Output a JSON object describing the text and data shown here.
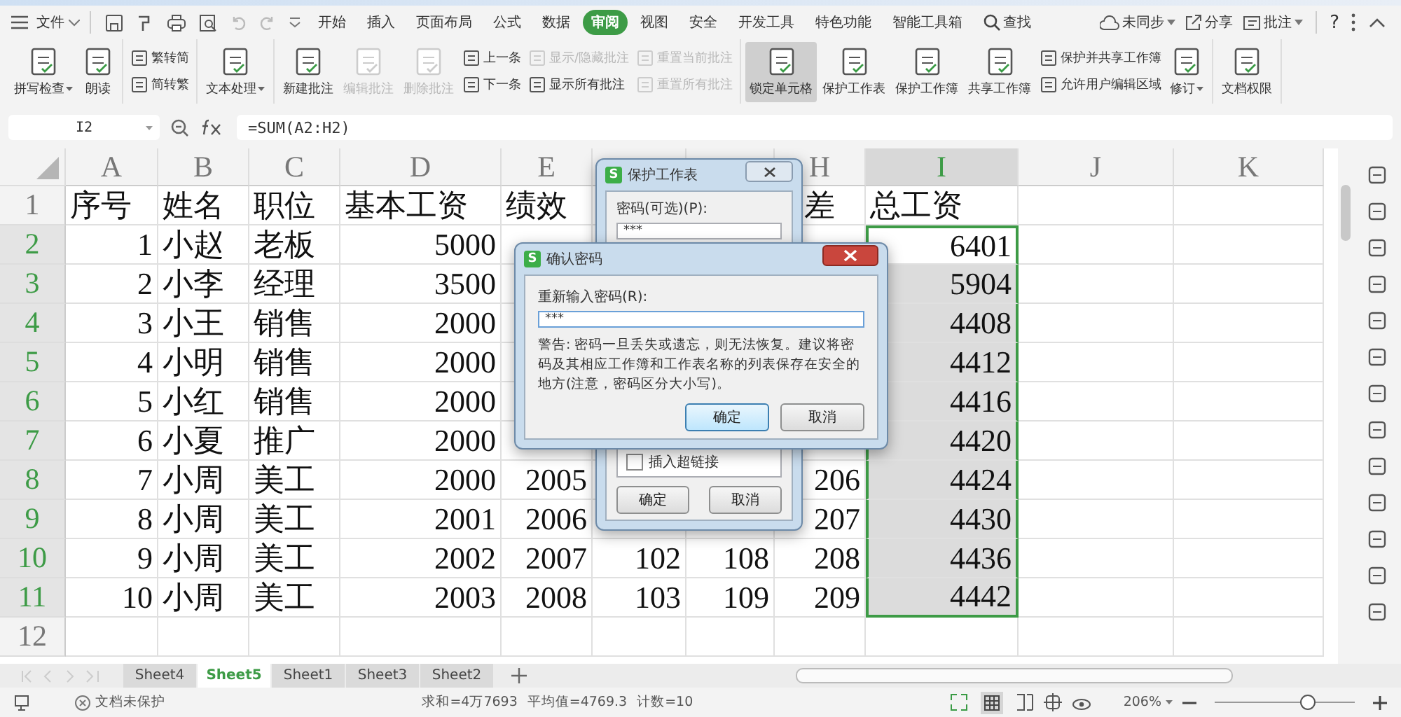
{
  "menu_bar": {
    "file": "文件",
    "tabs": [
      {
        "label": "开始",
        "selected": false
      },
      {
        "label": "插入",
        "selected": false
      },
      {
        "label": "页面布局",
        "selected": false
      },
      {
        "label": "公式",
        "selected": false
      },
      {
        "label": "数据",
        "selected": false
      },
      {
        "label": "审阅",
        "selected": true
      },
      {
        "label": "视图",
        "selected": false
      },
      {
        "label": "安全",
        "selected": false
      },
      {
        "label": "开发工具",
        "selected": false
      },
      {
        "label": "特色功能",
        "selected": false
      },
      {
        "label": "智能工具箱",
        "selected": false
      }
    ],
    "search": "查找",
    "sync": "未同步",
    "share": "分享",
    "comment": "批注",
    "help": "?"
  },
  "ribbon": [
    {
      "columns": [
        {
          "items": [
            {
              "kind": "large",
              "label": "拼写检查",
              "dropdown": true,
              "disabled": false,
              "pressed": false
            }
          ]
        },
        {
          "items": [
            {
              "kind": "large",
              "label": "朗读",
              "dropdown": false,
              "disabled": false,
              "pressed": false
            }
          ]
        }
      ]
    },
    {
      "columns": [
        {
          "items": [
            {
              "kind": "small",
              "label": "繁转简",
              "disabled": false
            },
            {
              "kind": "small",
              "label": "简转繁",
              "disabled": false
            }
          ]
        }
      ]
    },
    {
      "columns": [
        {
          "items": [
            {
              "kind": "large",
              "label": "文本处理",
              "dropdown": true,
              "disabled": false,
              "pressed": false
            }
          ]
        }
      ]
    },
    {
      "columns": [
        {
          "items": [
            {
              "kind": "large",
              "label": "新建批注",
              "dropdown": false,
              "disabled": false,
              "pressed": false
            }
          ]
        },
        {
          "items": [
            {
              "kind": "large",
              "label": "编辑批注",
              "dropdown": false,
              "disabled": true,
              "pressed": false
            }
          ]
        },
        {
          "items": [
            {
              "kind": "large",
              "label": "删除批注",
              "dropdown": false,
              "disabled": true,
              "pressed": false
            }
          ]
        },
        {
          "items": [
            {
              "kind": "small",
              "label": "上一条",
              "disabled": false
            },
            {
              "kind": "small",
              "label": "下一条",
              "disabled": false
            }
          ]
        },
        {
          "items": [
            {
              "kind": "small",
              "label": "显示/隐藏批注",
              "disabled": true
            },
            {
              "kind": "small",
              "label": "显示所有批注",
              "disabled": false
            }
          ]
        },
        {
          "items": [
            {
              "kind": "small",
              "label": "重置当前批注",
              "disabled": true
            },
            {
              "kind": "small",
              "label": "重置所有批注",
              "disabled": true
            }
          ]
        }
      ]
    },
    {
      "columns": [
        {
          "items": [
            {
              "kind": "large",
              "label": "锁定单元格",
              "dropdown": false,
              "disabled": false,
              "pressed": true
            }
          ]
        },
        {
          "items": [
            {
              "kind": "large",
              "label": "保护工作表",
              "dropdown": false,
              "disabled": false,
              "pressed": false
            }
          ]
        },
        {
          "items": [
            {
              "kind": "large",
              "label": "保护工作簿",
              "dropdown": false,
              "disabled": false,
              "pressed": false
            }
          ]
        },
        {
          "items": [
            {
              "kind": "large",
              "label": "共享工作簿",
              "dropdown": false,
              "disabled": false,
              "pressed": false
            }
          ]
        },
        {
          "items": [
            {
              "kind": "small",
              "label": "保护并共享工作簿",
              "disabled": false
            },
            {
              "kind": "small",
              "label": "允许用户编辑区域",
              "disabled": false
            }
          ]
        },
        {
          "items": [
            {
              "kind": "large",
              "label": "修订",
              "dropdown": true,
              "disabled": false,
              "pressed": false
            }
          ]
        }
      ]
    },
    {
      "columns": [
        {
          "items": [
            {
              "kind": "large",
              "label": "文档权限",
              "dropdown": false,
              "disabled": false,
              "pressed": false
            }
          ]
        }
      ]
    }
  ],
  "formula_bar": {
    "name_box": "I2",
    "formula": "=SUM(A2:H2)"
  },
  "sheet": {
    "columns": [
      {
        "label": "A",
        "selected": false
      },
      {
        "label": "B",
        "selected": false
      },
      {
        "label": "C",
        "selected": false
      },
      {
        "label": "D",
        "selected": false
      },
      {
        "label": "E",
        "selected": false
      },
      {
        "selected": false
      },
      {
        "selected": false
      },
      {
        "label": "H",
        "selected": false
      },
      {
        "label": "I",
        "selected": true
      },
      {
        "label": "J",
        "selected": false
      },
      {
        "label": "K",
        "selected": false
      }
    ],
    "rows": [
      {
        "num": "1",
        "kind": "header",
        "selected": false,
        "cells": [
          "序号",
          "姓名",
          "职位",
          "基本工资",
          "绩效",
          null,
          null,
          "差",
          "总工资"
        ]
      },
      {
        "num": "2",
        "kind": "data",
        "selected": true,
        "cells": [
          "1",
          "小赵",
          "老板",
          "5000",
          null,
          null,
          null,
          null,
          "6401"
        ]
      },
      {
        "num": "3",
        "kind": "data",
        "selected": true,
        "cells": [
          "2",
          "小李",
          "经理",
          "3500",
          null,
          null,
          null,
          null,
          "5904"
        ]
      },
      {
        "num": "4",
        "kind": "data",
        "selected": true,
        "cells": [
          "3",
          "小王",
          "销售",
          "2000",
          null,
          null,
          null,
          null,
          "4408"
        ]
      },
      {
        "num": "5",
        "kind": "data",
        "selected": true,
        "cells": [
          "4",
          "小明",
          "销售",
          "2000",
          null,
          null,
          null,
          null,
          "4412"
        ]
      },
      {
        "num": "6",
        "kind": "data",
        "selected": true,
        "cells": [
          "5",
          "小红",
          "销售",
          "2000",
          null,
          null,
          null,
          null,
          "4416"
        ]
      },
      {
        "num": "7",
        "kind": "data",
        "selected": true,
        "cells": [
          "6",
          "小夏",
          "推广",
          "2000",
          null,
          null,
          null,
          null,
          "4420"
        ]
      },
      {
        "num": "8",
        "kind": "data",
        "selected": true,
        "cells": [
          "7",
          "小周",
          "美工",
          "2000",
          "2005",
          null,
          null,
          "206",
          "4424"
        ]
      },
      {
        "num": "9",
        "kind": "data",
        "selected": true,
        "cells": [
          "8",
          "小周",
          "美工",
          "2001",
          "2006",
          null,
          null,
          "207",
          "4430"
        ]
      },
      {
        "num": "10",
        "kind": "data",
        "selected": true,
        "cells": [
          "9",
          "小周",
          "美工",
          "2002",
          "2007",
          "102",
          "108",
          "208",
          "4436"
        ]
      },
      {
        "num": "11",
        "kind": "data",
        "selected": true,
        "cells": [
          "10",
          "小周",
          "美工",
          "2003",
          "2008",
          "103",
          "109",
          "209",
          "4442"
        ]
      },
      {
        "num": "12",
        "kind": "data",
        "selected": false
      }
    ]
  },
  "protect_dialog": {
    "logo": "S",
    "title": "保护工作表",
    "password_label": "密码(可选)(P):",
    "password_value": "***",
    "options": [
      {
        "label": "插入超链接",
        "checked": false
      }
    ],
    "ok": "确定",
    "cancel": "取消"
  },
  "confirm_dialog": {
    "logo": "S",
    "title": "确认密码",
    "prompt": "重新输入密码(R):",
    "value": "***",
    "warning": "警告: 密码一旦丢失或遗忘，则无法恢复。建议将密码及其相应工作簿和工作表名称的列表保存在安全的地方(注意，密码区分大小写)。",
    "ok": "确定",
    "cancel": "取消"
  },
  "sheet_tabs": [
    {
      "label": "Sheet4",
      "selected": false
    },
    {
      "label": "Sheet5",
      "selected": true
    },
    {
      "label": "Sheet1",
      "selected": false
    },
    {
      "label": "Sheet3",
      "selected": false
    },
    {
      "label": "Sheet2",
      "selected": false
    }
  ],
  "status_bar": {
    "protection": "文档未保护",
    "sum": "求和=4万7693",
    "average": "平均值=4769.3",
    "count": "计数=10",
    "zoom": "206%",
    "zoom_slider": {
      "level": 0.66
    }
  }
}
